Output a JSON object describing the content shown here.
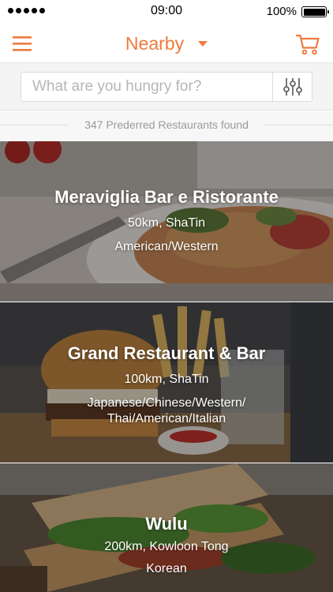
{
  "status_bar": {
    "time": "09:00",
    "battery": "100%"
  },
  "navbar": {
    "title": "Nearby"
  },
  "search": {
    "placeholder": "What are you hungry for?",
    "value": ""
  },
  "results": {
    "count_text": "347 Prederred Restaurants found"
  },
  "restaurants": [
    {
      "name": "Meraviglia Bar e Ristorante",
      "distance": "50km, ShaTin",
      "cuisine_lines": [
        "American/Western"
      ]
    },
    {
      "name": "Grand Restaurant & Bar",
      "distance": "100km, ShaTin",
      "cuisine_lines": [
        "Japanese/Chinese/Western/",
        "Thai/American/Italian"
      ]
    },
    {
      "name": "Wulu",
      "distance": "200km, Kowloon Tong",
      "cuisine_lines": [
        "Korean"
      ]
    }
  ],
  "colors": {
    "accent": "#ef7a3b"
  },
  "icons": {
    "menu": "hamburger-menu-icon",
    "dropdown": "chevron-down-icon",
    "cart": "shopping-cart-icon",
    "filter": "sliders-filter-icon"
  }
}
